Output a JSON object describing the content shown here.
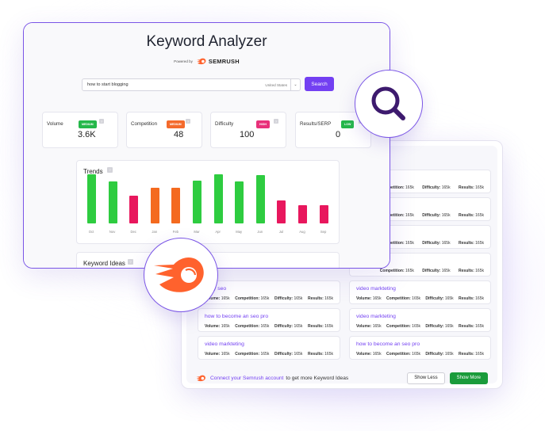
{
  "app": {
    "title": "Keyword Analyzer",
    "powered_by": "Powered by",
    "brand": "SEMRUSH"
  },
  "search": {
    "query": "how to start blogging",
    "country": "United States",
    "button_label": "Search"
  },
  "metrics": [
    {
      "label": "Volume",
      "badge": "MEDIUM",
      "badge_color": "#25b84a",
      "value": "3.6K"
    },
    {
      "label": "Competition",
      "badge": "MEDIUM",
      "badge_color": "#f46a2c",
      "value": "48"
    },
    {
      "label": "Difficulty",
      "badge": "HIGH",
      "badge_color": "#e8317a",
      "value": "100"
    },
    {
      "label": "Results/SERP",
      "badge": "LOW",
      "badge_color": "#25b84a",
      "value": "0"
    }
  ],
  "trends": {
    "title": "Trends",
    "info_icon": "info-icon",
    "chart_data": {
      "type": "bar",
      "title": "Trends",
      "categories": [
        "Oct",
        "Nov",
        "Dec",
        "Jan",
        "Feb",
        "Mar",
        "Apr",
        "May",
        "Jun",
        "Jul",
        "Aug",
        "Sep"
      ],
      "values": [
        100,
        86,
        57,
        72,
        72,
        87,
        100,
        86,
        99,
        47,
        37,
        37
      ],
      "colors": [
        "#2ecc40",
        "#2ecc40",
        "#e8175d",
        "#f46a1f",
        "#f46a1f",
        "#2ecc40",
        "#2ecc40",
        "#2ecc40",
        "#2ecc40",
        "#e8175d",
        "#e8175d",
        "#e8175d"
      ],
      "ylim": [
        0,
        100
      ],
      "grid": false,
      "legend": "none"
    }
  },
  "keyword_ideas": {
    "title": "Keyword Ideas",
    "metric_labels": {
      "volume": "Volume:",
      "competition": "Competition:",
      "difficulty": "Difficulty:",
      "results": "Results:"
    },
    "items": [
      {
        "title": "e",
        "volume": "",
        "competition": "165k",
        "difficulty": "165k",
        "results": "165k"
      },
      {
        "title": "",
        "volume": "",
        "competition": "165k",
        "difficulty": "165k",
        "results": "165k"
      },
      {
        "title": "eo pro",
        "volume": "",
        "competition": "165k",
        "difficulty": "165k",
        "results": "165k"
      },
      {
        "title": "eo pro",
        "volume": "",
        "competition": "165k",
        "difficulty": "165k",
        "results": "165k"
      },
      {
        "title": "...ldy seo",
        "volume": "165k",
        "competition": "165k",
        "difficulty": "165k",
        "results": "165k"
      },
      {
        "title": "video markteting",
        "volume": "165k",
        "competition": "165k",
        "difficulty": "165k",
        "results": "165k"
      },
      {
        "title": "how to become an seo pro",
        "volume": "165k",
        "competition": "165k",
        "difficulty": "165k",
        "results": "165k"
      },
      {
        "title": "video markteting",
        "volume": "165k",
        "competition": "165k",
        "difficulty": "165k",
        "results": "165k"
      },
      {
        "title": "video markteting",
        "volume": "165k",
        "competition": "165k",
        "difficulty": "165k",
        "results": "165k"
      },
      {
        "title": "how to become an seo pro",
        "volume": "165k",
        "competition": "165k",
        "difficulty": "165k",
        "results": "165k"
      }
    ],
    "cta_link": "Connect your Semrush account",
    "cta_rest": "to get more Keyword Ideas",
    "show_less": "Show Less",
    "show_more": "Show More"
  },
  "colors": {
    "accent": "#7340f2",
    "show_more": "#1a9b3b",
    "semrush_orange": "#ff622d"
  }
}
